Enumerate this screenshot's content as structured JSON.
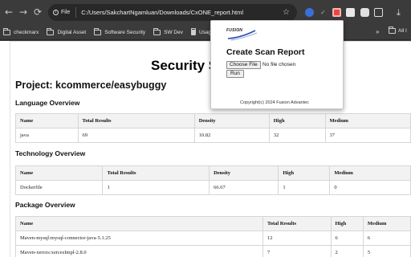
{
  "browser": {
    "scheme_label": "File",
    "url": "C:/Users/SakchartNgamluan/Downloads/CxONE_report.html",
    "bookmarks": [
      "checkmarx",
      "Digital Asset",
      "Software Security",
      "SW Dev",
      "Usage - Op"
    ],
    "more_label": "»",
    "all_bookmarks_label": "All I"
  },
  "report": {
    "title": "Security S",
    "project": "Project: kcommerce/easybuggy",
    "language": {
      "heading": "Language Overview",
      "columns": [
        "Name",
        "Total Results",
        "Density",
        "High",
        "Medium"
      ],
      "rows": [
        [
          "java",
          "69",
          "10.82",
          "32",
          "37"
        ]
      ]
    },
    "technology": {
      "heading": "Technology Overview",
      "columns": [
        "Name",
        "Total Results",
        "Density",
        "High",
        "Medium"
      ],
      "rows": [
        [
          "Dockerfile",
          "1",
          "66.67",
          "1",
          "0"
        ]
      ]
    },
    "package": {
      "heading": "Package Overview",
      "columns": [
        "Name",
        "Total Results",
        "High",
        "Medium"
      ],
      "rows": [
        [
          "Maven-mysql:mysql-connector-java-5.1.25",
          "12",
          "6",
          "6"
        ],
        [
          "Maven-xerces:xercesImpl-2.8.0",
          "7",
          "2",
          "5"
        ]
      ]
    }
  },
  "popup": {
    "logo_text": "FUSION",
    "title": "Create Scan Report",
    "choose_file_label": "Choose File",
    "file_status": "No file chosen",
    "run_label": "Run",
    "copyright": "Copyright(c) 2024 Fusion Advantec"
  },
  "icons": {
    "back": "back-arrow-icon",
    "forward": "forward-arrow-icon",
    "reload": "reload-icon",
    "star": "bookmark-star-icon",
    "download": "download-icon"
  },
  "colors": {
    "chrome": "#3b3b3b",
    "omnibox": "#282828",
    "table_header": "#f2f2f2",
    "logo_blue": "#2b4fa8"
  }
}
